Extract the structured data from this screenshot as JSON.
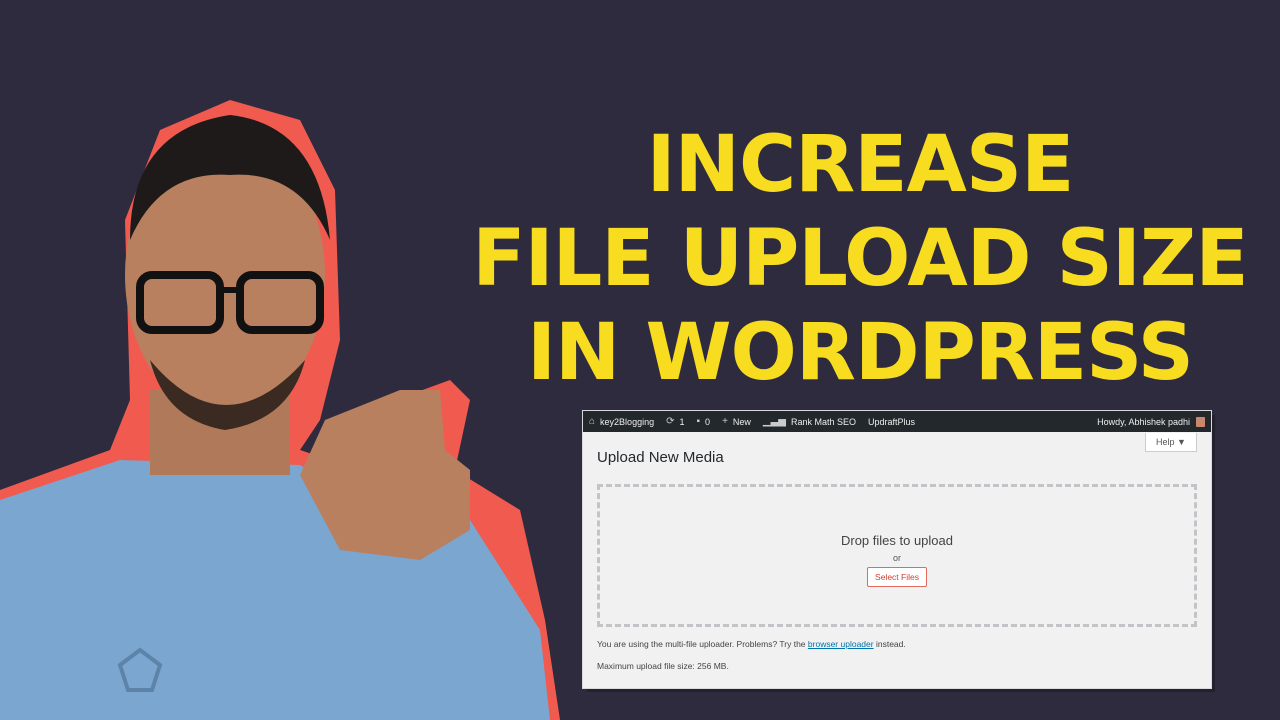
{
  "headline": {
    "line1": "INCREASE",
    "line2": "FILE UPLOAD SIZE",
    "line3": "IN WORDPRESS"
  },
  "colors": {
    "background": "#2f2b3f",
    "headline": "#f7dc1f",
    "outline": "#f05a4f",
    "shirt": "#7aa6cf"
  },
  "wordpress": {
    "admin_bar": {
      "site_name": "key2Blogging",
      "updates_count": "1",
      "comments_count": "0",
      "new_label": "New",
      "rank_math": "Rank Math SEO",
      "updraft": "UpdraftPlus",
      "howdy": "Howdy, Abhishek padhi"
    },
    "help_label": "Help ▼",
    "page_title": "Upload New Media",
    "drop_text": "Drop files to upload",
    "or_text": "or",
    "select_files_label": "Select Files",
    "info_prefix": "You are using the multi-file uploader. Problems? Try the",
    "info_link": "browser uploader",
    "info_suffix": "instead.",
    "max_upload": "Maximum upload file size: 256 MB."
  }
}
